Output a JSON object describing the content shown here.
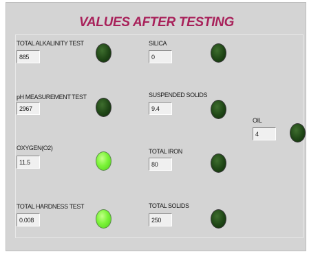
{
  "title": "VALUES AFTER TESTING",
  "tests": [
    {
      "label": "TOTAL ALKALINITY TEST",
      "value": "885",
      "indicator": "off"
    },
    {
      "label": "pH MEASUREMENT TEST",
      "value": "2967",
      "indicator": "off"
    },
    {
      "label": "OXYGEN(O2)",
      "value": "11.5",
      "indicator": "on"
    },
    {
      "label": "TOTAL HARDNESS TEST",
      "value": "0.008",
      "indicator": "on"
    },
    {
      "label": "SILICA",
      "value": "0",
      "indicator": "off"
    },
    {
      "label": "SUSPENDED SOLIDS",
      "value": "9.4",
      "indicator": "off"
    },
    {
      "label": "TOTAL IRON",
      "value": "80",
      "indicator": "off"
    },
    {
      "label": "TOTAL SOLIDS",
      "value": "250",
      "indicator": "off"
    },
    {
      "label": "OIL",
      "value": "4",
      "indicator": "off"
    }
  ],
  "colors": {
    "title": "#a8215a",
    "panel": "#d4d4d4",
    "led_on": "#7df43a",
    "led_off": "#1f4616"
  }
}
